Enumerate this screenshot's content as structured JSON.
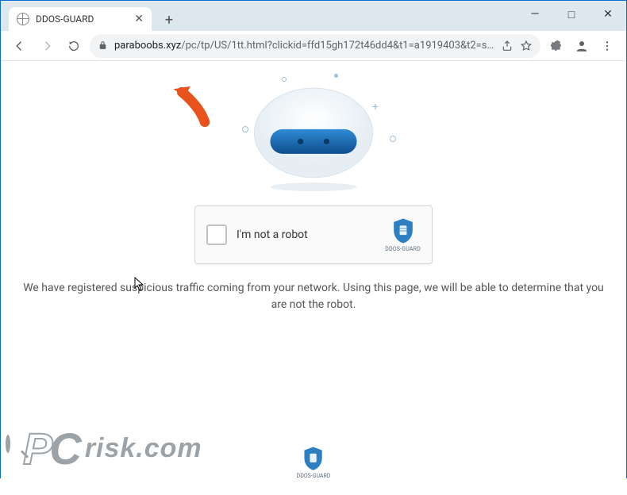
{
  "browser": {
    "tab_title": "DDOS-GUARD",
    "url_domain": "paraboobs.xyz",
    "url_path": "/pc/tp/US/1tt.html?clickid=ffd15gh172t46dd4&t1=a1919403&t2=s02513...",
    "window_buttons": {
      "min": "—",
      "max": "□",
      "close": "✕"
    }
  },
  "page": {
    "captcha_label": "I'm not a robot",
    "guard_badge_text": "DDOS-GUARD",
    "notice": "We have registered suspicious traffic coming from your network. Using this page, we will be able to determine that you are not the robot.",
    "footer_badge_text": "DDOS-GUARD"
  },
  "watermark": {
    "text": "risk.com"
  }
}
